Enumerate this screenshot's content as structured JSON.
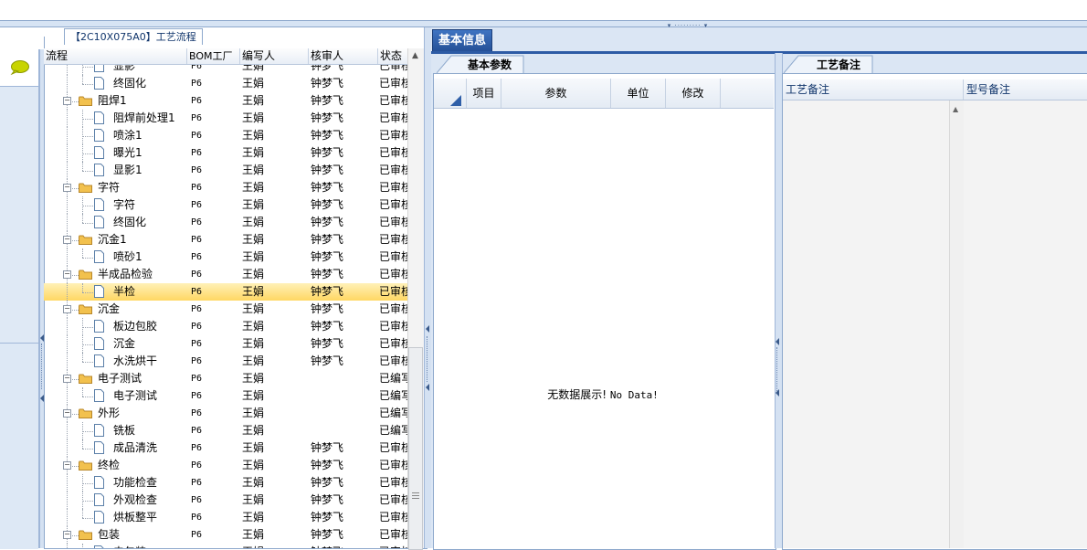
{
  "tree": {
    "title": "【2C10X075A0】工艺流程",
    "columns": [
      "流程",
      "BOM工厂",
      "编写人",
      "核审人",
      "状态"
    ],
    "rows": [
      {
        "name": "显影",
        "level": 2,
        "type": "doc",
        "bom": "P6",
        "writer": "王娟",
        "reviewer": "钟梦飞",
        "status": "已审核"
      },
      {
        "name": "终固化",
        "level": 2,
        "type": "doc",
        "bom": "P6",
        "writer": "王娟",
        "reviewer": "钟梦飞",
        "status": "已审核"
      },
      {
        "name": "阻焊1",
        "level": 1,
        "type": "folder",
        "bom": "P6",
        "writer": "王娟",
        "reviewer": "钟梦飞",
        "status": "已审核"
      },
      {
        "name": "阻焊前处理1",
        "level": 2,
        "type": "doc",
        "bom": "P6",
        "writer": "王娟",
        "reviewer": "钟梦飞",
        "status": "已审核"
      },
      {
        "name": "喷涂1",
        "level": 2,
        "type": "doc",
        "bom": "P6",
        "writer": "王娟",
        "reviewer": "钟梦飞",
        "status": "已审核"
      },
      {
        "name": "曝光1",
        "level": 2,
        "type": "doc",
        "bom": "P6",
        "writer": "王娟",
        "reviewer": "钟梦飞",
        "status": "已审核"
      },
      {
        "name": "显影1",
        "level": 2,
        "type": "doc",
        "bom": "P6",
        "writer": "王娟",
        "reviewer": "钟梦飞",
        "status": "已审核"
      },
      {
        "name": "字符",
        "level": 1,
        "type": "folder",
        "bom": "P6",
        "writer": "王娟",
        "reviewer": "钟梦飞",
        "status": "已审核"
      },
      {
        "name": "字符",
        "level": 2,
        "type": "doc",
        "bom": "P6",
        "writer": "王娟",
        "reviewer": "钟梦飞",
        "status": "已审核"
      },
      {
        "name": "终固化",
        "level": 2,
        "type": "doc",
        "bom": "P6",
        "writer": "王娟",
        "reviewer": "钟梦飞",
        "status": "已审核"
      },
      {
        "name": "沉金1",
        "level": 1,
        "type": "folder",
        "bom": "P6",
        "writer": "王娟",
        "reviewer": "钟梦飞",
        "status": "已审核"
      },
      {
        "name": "喷砂1",
        "level": 2,
        "type": "doc",
        "bom": "P6",
        "writer": "王娟",
        "reviewer": "钟梦飞",
        "status": "已审核"
      },
      {
        "name": "半成品检验",
        "level": 1,
        "type": "folder",
        "bom": "P6",
        "writer": "王娟",
        "reviewer": "钟梦飞",
        "status": "已审核"
      },
      {
        "name": "半检",
        "level": 2,
        "type": "doc",
        "bom": "P6",
        "writer": "王娟",
        "reviewer": "钟梦飞",
        "status": "已审核",
        "selected": true
      },
      {
        "name": "沉金",
        "level": 1,
        "type": "folder",
        "bom": "P6",
        "writer": "王娟",
        "reviewer": "钟梦飞",
        "status": "已审核"
      },
      {
        "name": "板边包胶",
        "level": 2,
        "type": "doc",
        "bom": "P6",
        "writer": "王娟",
        "reviewer": "钟梦飞",
        "status": "已审核"
      },
      {
        "name": "沉金",
        "level": 2,
        "type": "doc",
        "bom": "P6",
        "writer": "王娟",
        "reviewer": "钟梦飞",
        "status": "已审核"
      },
      {
        "name": "水洗烘干",
        "level": 2,
        "type": "doc",
        "bom": "P6",
        "writer": "王娟",
        "reviewer": "钟梦飞",
        "status": "已审核"
      },
      {
        "name": "电子测试",
        "level": 1,
        "type": "folder",
        "bom": "P6",
        "writer": "王娟",
        "reviewer": "",
        "status": "已编写"
      },
      {
        "name": "电子测试",
        "level": 2,
        "type": "doc",
        "bom": "P6",
        "writer": "王娟",
        "reviewer": "",
        "status": "已编写"
      },
      {
        "name": "外形",
        "level": 1,
        "type": "folder",
        "bom": "P6",
        "writer": "王娟",
        "reviewer": "",
        "status": "已编写"
      },
      {
        "name": "铣板",
        "level": 2,
        "type": "doc",
        "bom": "P6",
        "writer": "王娟",
        "reviewer": "",
        "status": "已编写"
      },
      {
        "name": "成品清洗",
        "level": 2,
        "type": "doc",
        "bom": "P6",
        "writer": "王娟",
        "reviewer": "钟梦飞",
        "status": "已审核"
      },
      {
        "name": "终检",
        "level": 1,
        "type": "folder",
        "bom": "P6",
        "writer": "王娟",
        "reviewer": "钟梦飞",
        "status": "已审核"
      },
      {
        "name": "功能检查",
        "level": 2,
        "type": "doc",
        "bom": "P6",
        "writer": "王娟",
        "reviewer": "钟梦飞",
        "status": "已审核"
      },
      {
        "name": "外观检查",
        "level": 2,
        "type": "doc",
        "bom": "P6",
        "writer": "王娟",
        "reviewer": "钟梦飞",
        "status": "已审核"
      },
      {
        "name": "烘板整平",
        "level": 2,
        "type": "doc",
        "bom": "P6",
        "writer": "王娟",
        "reviewer": "钟梦飞",
        "status": "已审核"
      },
      {
        "name": "包装",
        "level": 1,
        "type": "folder",
        "bom": "P6",
        "writer": "王娟",
        "reviewer": "钟梦飞",
        "status": "已审核"
      },
      {
        "name": "电包装",
        "level": 2,
        "type": "doc",
        "bom": "P6",
        "writer": "王娟",
        "reviewer": "钟梦飞",
        "status": "已审核"
      }
    ]
  },
  "right": {
    "main_tab": "基本信息",
    "params_tab": "基本参数",
    "params_columns": [
      "项目",
      "参数",
      "单位",
      "修改"
    ],
    "no_data": {
      "cn": "无数据展示!",
      "en": "No Data!"
    },
    "process_tab": "工艺备注",
    "notes_columns": [
      "工艺备注",
      "型号备注"
    ]
  },
  "colors": {
    "accent": "#2d5ba5",
    "selected_row": "#ffd763",
    "folder": "#f2c14e"
  },
  "icons": {
    "chat": "speech-bubble-icon",
    "folder": "folder-icon",
    "doc": "document-icon"
  }
}
